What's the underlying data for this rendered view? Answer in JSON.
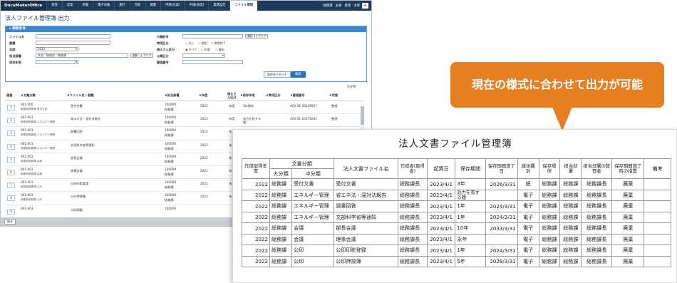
{
  "app": {
    "logo": "DocuMakerOffice",
    "nav": [
      "収受",
      "起案",
      "供覧",
      "電子決裁",
      "施行",
      "完結",
      "廃棄",
      "申請(作成)",
      "申請(承認)",
      "業務設定",
      "ファイル管理"
    ],
    "user": "総務課　主事　管理　太郎",
    "page_title": "法人ファイル管理簿 出力",
    "search": {
      "header": "検索条件",
      "file_name_label": "ファイル名",
      "subtitle_label": "副題",
      "year_label": "年度",
      "year_value": "2022",
      "dept_label": "担当部署",
      "dept_value": "本部／総務部／総務課",
      "keep_year_label": "保存年限",
      "sel_btn": "選択",
      "clear_btn": "クリア",
      "category_label": "分類記号",
      "usage_label": "常用区分",
      "usage_opts": [
        "○ なし",
        "○ 常用",
        "○ 常用終了"
      ],
      "count_label": "揃えさん区分",
      "count_opts": [
        "◉ すべて",
        "○ 年度",
        "○ 暦年"
      ],
      "public_label": "公開区分",
      "mgmt_label": "管理番号",
      "reset_btn": "条件をリセット",
      "search_btn": "検索"
    },
    "result_count": "［63件］",
    "grid_headers": [
      "連番",
      "文書分類",
      "ファイル名 / 副題",
      "担当部署",
      "年度",
      "揃えさん区分",
      "保存年限",
      "常用区分",
      "管理番号",
      "状態"
    ],
    "rows": [
      {
        "n": "1",
        "code": "001-000",
        "cls": "総務部総務課-受付文書",
        "file": "受付文書",
        "dept1": "100009",
        "dept2": "総務課",
        "year": "2022",
        "kb": "年度",
        "keep": "3年保存",
        "usage": "",
        "mgmt": "A03-01-20229047",
        "state": "整理"
      },
      {
        "n": "2",
        "code": "001-001",
        "cls": "総務部総務課-エネルギー管理",
        "file": "省エネ法・温対法報告",
        "dept1": "100009",
        "dept2": "総務課",
        "year": "2022",
        "kb": "年度",
        "keep": "効力を有する間",
        "usage": "",
        "mgmt": "A03-01-20176042",
        "state": "整理"
      },
      {
        "n": "3",
        "code": "001-001",
        "cls": "総務部総務課-エネルギー管理",
        "file": "調書回答",
        "dept1": "100009",
        "dept2": "総務課",
        "year": "2022",
        "kb": "年度",
        "keep": "",
        "usage": "",
        "mgmt": "",
        "state": ""
      },
      {
        "n": "4",
        "code": "001-001",
        "cls": "総務部総務課-エネルギー管理",
        "file": "文部科学省等通知",
        "dept1": "100009",
        "dept2": "総務課",
        "year": "2022",
        "kb": "年度",
        "keep": "",
        "usage": "",
        "mgmt": "",
        "state": ""
      },
      {
        "n": "5",
        "code": "001-002",
        "cls": "総務部総務課-会議",
        "file": "部長会議",
        "dept1": "100009",
        "dept2": "総務課",
        "year": "2022",
        "kb": "年度",
        "keep": "",
        "usage": "",
        "mgmt": "",
        "state": ""
      },
      {
        "n": "6",
        "code": "001-002",
        "cls": "総務部総務課-会議",
        "file": "理事会議",
        "dept1": "100009",
        "dept2": "総務課",
        "year": "2022",
        "kb": "年度",
        "keep": "",
        "usage": "",
        "mgmt": "",
        "state": ""
      },
      {
        "n": "7",
        "code": "001-003",
        "cls": "総務部総務課-公印",
        "file": "公印印影要請",
        "dept1": "100009",
        "dept2": "総務課",
        "year": "2022",
        "kb": "年度",
        "keep": "",
        "usage": "",
        "mgmt": "",
        "state": ""
      },
      {
        "n": "8",
        "code": "001-003",
        "cls": "総務部総務課-公印",
        "file": "公印押捺簿",
        "dept1": "100009",
        "dept2": "総務課",
        "year": "2022",
        "kb": "年度",
        "keep": "",
        "usage": "",
        "mgmt": "",
        "state": ""
      },
      {
        "n": "9",
        "code": "001-003",
        "cls": "",
        "file": "公印調製",
        "dept1": "100009",
        "dept2": "",
        "year": "",
        "kb": "",
        "keep": "",
        "usage": "",
        "mgmt": "",
        "state": ""
      }
    ],
    "back_btn": "戻る"
  },
  "callout": "現在の様式に合わせて出力が可能",
  "doc": {
    "title": "法人文書ファイル管理簿",
    "headers": {
      "year": "作成取得年度",
      "cls": "文書分類",
      "major": "大分類",
      "minor": "中分類",
      "file": "法人文書ファイル名",
      "creator": "作成者(取得者)",
      "start": "起算日",
      "period": "保存期間",
      "expiry": "保存期間満了日",
      "media": "媒体種別",
      "place": "保存場所",
      "dept": "担当部署",
      "manager": "担当部署の管理者",
      "action": "保存期間満了時の措置",
      "note": "備考"
    },
    "rows": [
      [
        "2022",
        "総務課",
        "受付文書",
        "受付文書",
        "総務課長",
        "2023/4/1",
        "3年",
        "2026/3/31",
        "紙",
        "総務課",
        "総務課",
        "総務課長",
        "廃棄",
        ""
      ],
      [
        "2022",
        "総務課",
        "エネルギー管理",
        "省エネ法・温対法報告",
        "総務課長",
        "2023/4/1",
        "効力を有する間",
        "",
        "電子",
        "総務課",
        "総務課",
        "総務課長",
        "廃棄",
        ""
      ],
      [
        "2022",
        "総務課",
        "エネルギー管理",
        "調書回答",
        "総務課長",
        "2023/4/1",
        "1年",
        "2024/3/31",
        "電子",
        "総務課",
        "総務課",
        "総務課長",
        "廃棄",
        ""
      ],
      [
        "2022",
        "総務課",
        "エネルギー管理",
        "文部科学省等通知",
        "総務課長",
        "2023/4/1",
        "1年",
        "2024/3/31",
        "電子",
        "総務課",
        "総務課",
        "総務課長",
        "廃棄",
        ""
      ],
      [
        "2022",
        "総務課",
        "会議",
        "部長会議",
        "総務課長",
        "2023/4/1",
        "10年",
        "2033/3/31",
        "電子",
        "総務課",
        "総務課",
        "総務課長",
        "廃棄",
        ""
      ],
      [
        "2022",
        "総務課",
        "会議",
        "理事会議",
        "総務課長",
        "2023/4/1",
        "永年",
        "",
        "電子",
        "総務課",
        "総務課",
        "総務課長",
        "廃棄",
        ""
      ],
      [
        "2022",
        "総務課",
        "公印",
        "公印印影登録",
        "総務課長",
        "2023/4/1",
        "1年",
        "2024/3/31",
        "電子",
        "総務課",
        "総務課",
        "総務課長",
        "廃棄",
        ""
      ],
      [
        "2022",
        "総務課",
        "公印",
        "公印押捺簿",
        "総務課長",
        "2023/4/1",
        "5年",
        "2028/3/31",
        "電子",
        "総務課",
        "総務課",
        "総務課長",
        "廃棄",
        ""
      ]
    ]
  }
}
